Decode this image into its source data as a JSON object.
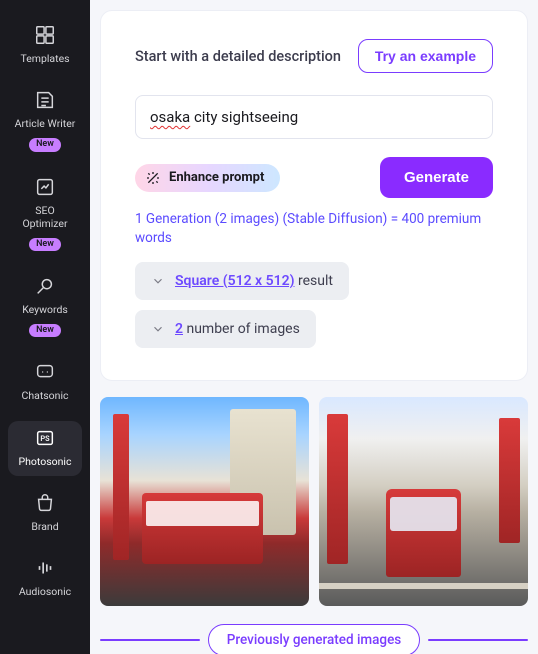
{
  "sidebar": {
    "items": [
      {
        "label": "Templates",
        "badge": null
      },
      {
        "label": "Article Writer",
        "badge": "New"
      },
      {
        "label": "SEO Optimizer",
        "badge": "New"
      },
      {
        "label": "Keywords",
        "badge": "New"
      },
      {
        "label": "Chatsonic",
        "badge": null
      },
      {
        "label": "Photosonic",
        "badge": null
      },
      {
        "label": "Brand",
        "badge": null
      },
      {
        "label": "Audiosonic",
        "badge": null
      }
    ]
  },
  "card": {
    "desc": "Start with a detailed description",
    "try_example": "Try an example",
    "prompt_spell": "osaka",
    "prompt_rest": " city sightseeing",
    "enhance": "Enhance prompt",
    "generate": "Generate",
    "cost": "1 Generation (2 images) (Stable Diffusion) = 400 premium words",
    "size_value": "Square (512 x 512)",
    "size_suffix": " result",
    "count_value": "2",
    "count_suffix": " number of images"
  },
  "previous_label": "Previously generated images"
}
